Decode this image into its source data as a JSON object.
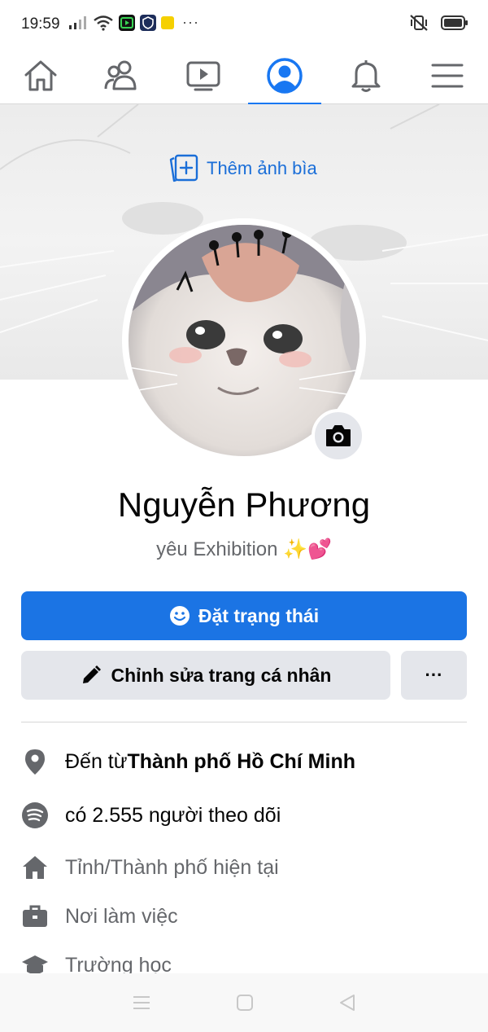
{
  "status_bar": {
    "time": "19:59",
    "more": "···"
  },
  "nav": {
    "tabs": [
      {
        "name": "home",
        "icon": "home-icon"
      },
      {
        "name": "friends",
        "icon": "friends-icon"
      },
      {
        "name": "watch",
        "icon": "video-icon"
      },
      {
        "name": "profile",
        "icon": "profile-icon",
        "active": true
      },
      {
        "name": "notifications",
        "icon": "bell-icon"
      },
      {
        "name": "menu",
        "icon": "hamburger-menu-icon"
      }
    ]
  },
  "cover": {
    "add_cover_label": "Thêm ảnh bìa"
  },
  "profile": {
    "name": "Nguyễn Phương",
    "bio": "yêu Exhibition ✨💕"
  },
  "actions": {
    "status_label": "Đặt trạng thái",
    "edit_label": "Chỉnh sửa trang cá nhân",
    "more_label": "···"
  },
  "details": {
    "from_prefix": "Đến từ ",
    "from_value": "Thành phố Hồ Chí Minh",
    "followers": "có 2.555 người theo dõi",
    "current_city": "Tỉnh/Thành phố hiện tại",
    "workplace": "Nơi làm việc",
    "school": "Trường học"
  },
  "colors": {
    "accent": "#1877f2",
    "button_primary": "#1b74e4",
    "button_secondary": "#e4e6eb",
    "muted_text": "#65676b"
  }
}
